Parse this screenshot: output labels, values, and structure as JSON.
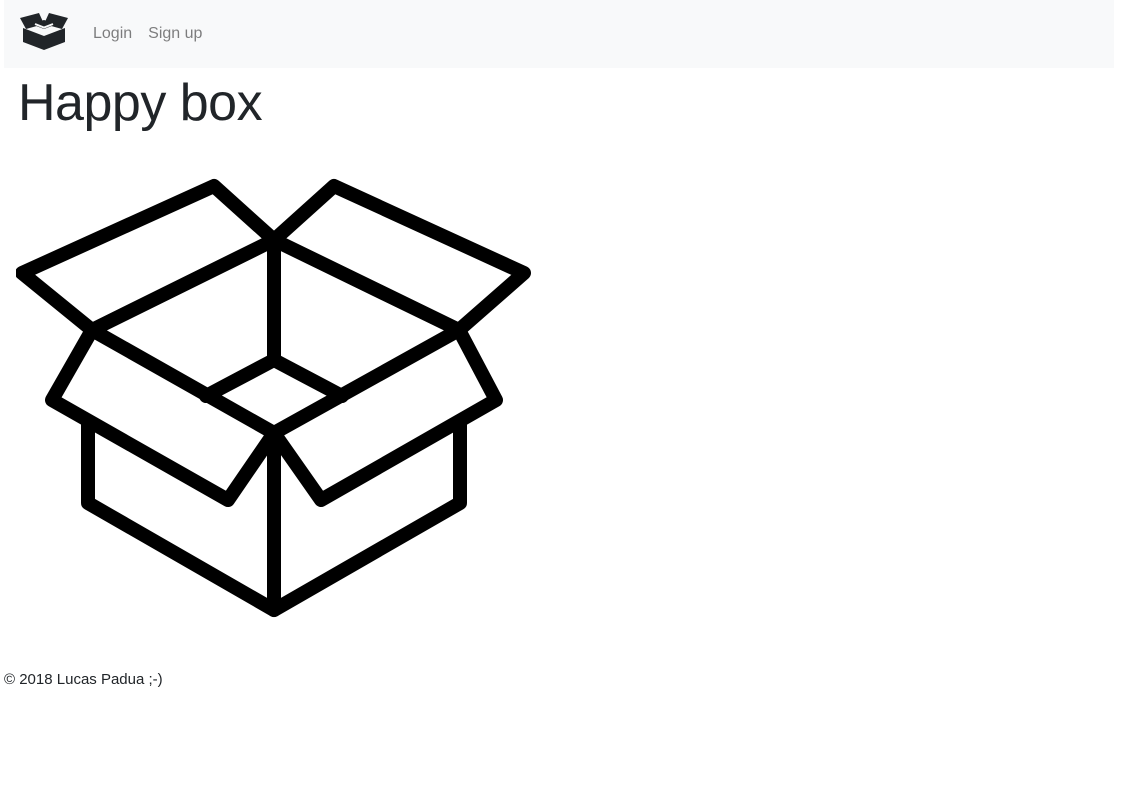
{
  "navbar": {
    "logo_icon": "open-box-icon",
    "links": [
      {
        "label": "Login"
      },
      {
        "label": "Sign up"
      }
    ]
  },
  "main": {
    "title": "Happy box",
    "image_icon": "open-box-outline-icon"
  },
  "footer": {
    "text": "© 2018 Lucas Padua ;-)"
  },
  "colors": {
    "navbar_bg": "#f8f9fa",
    "text": "#212529",
    "nav_link": "#7f7f7f",
    "icon": "#000000"
  }
}
